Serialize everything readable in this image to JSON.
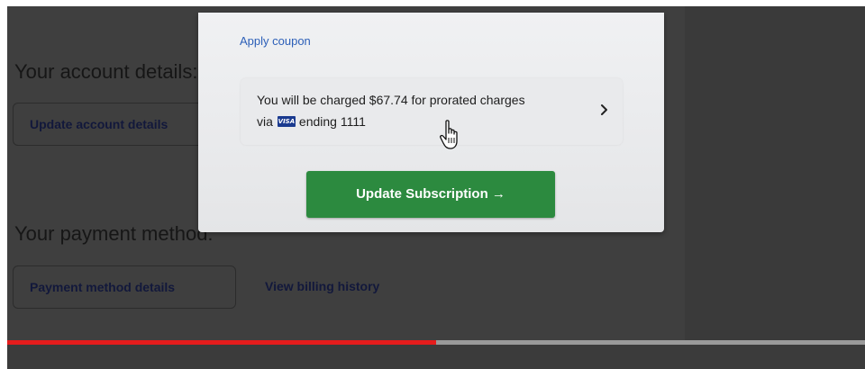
{
  "background_page": {
    "account_section_title": "Your account details:",
    "update_account_button": "Update account details",
    "payment_section_title": "Your payment method:",
    "payment_details_button": "Payment method details",
    "billing_history_link": "View billing history"
  },
  "modal": {
    "coupon_link": "Apply coupon",
    "charge": {
      "line1": "You will be charged $67.74 for prorated charges",
      "via": "via",
      "card_brand": "VISA",
      "card_suffix": "ending 1111"
    },
    "primary_button": "Update Subscription →"
  },
  "video_player": {
    "progress": 0.5
  },
  "colors": {
    "primary_green": "#2c8a3f",
    "link_blue": "#2c5fb8",
    "progress_red": "#e51c1c",
    "visa_blue": "#1a3a8f"
  },
  "icons": {
    "chevron": "chevron-right-icon",
    "cursor": "hand-pointer-icon",
    "card": "visa-card-icon"
  }
}
